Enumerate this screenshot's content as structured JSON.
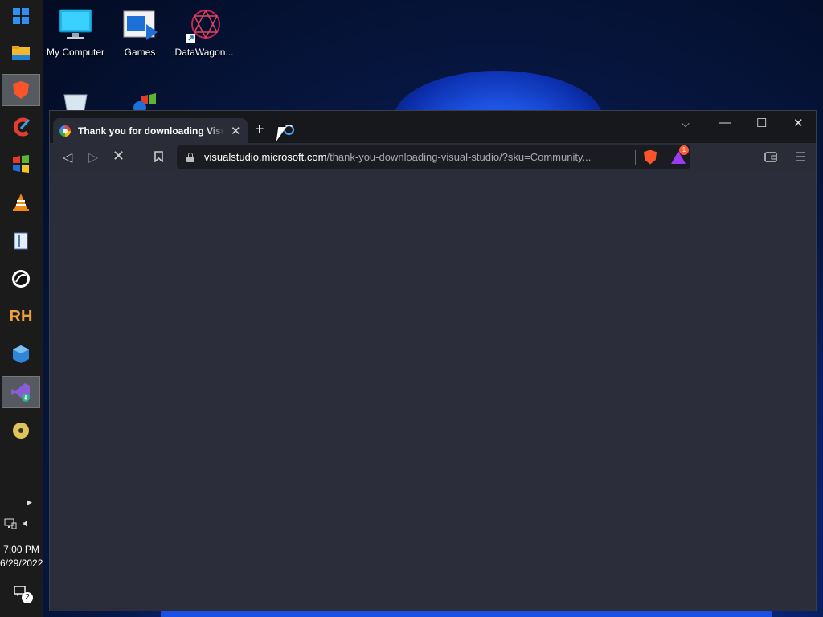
{
  "desktop": {
    "icons": [
      {
        "label": "My Computer",
        "icon": "monitor-icon"
      },
      {
        "label": "Games",
        "icon": "games-icon"
      },
      {
        "label": "DataWagon...",
        "icon": "datawagon-icon"
      }
    ]
  },
  "taskbar": {
    "apps": [
      {
        "icon": "windows-start-icon"
      },
      {
        "icon": "file-explorer-icon"
      },
      {
        "icon": "brave-browser-icon",
        "active": true
      },
      {
        "icon": "ccleaner-icon"
      },
      {
        "icon": "windows-xp-icon"
      },
      {
        "icon": "vlc-icon"
      },
      {
        "icon": "book-reader-icon"
      },
      {
        "icon": "inkscape-icon"
      },
      {
        "icon": "resource-hacker-icon"
      },
      {
        "icon": "cube-app-icon"
      },
      {
        "icon": "visual-studio-installer-icon",
        "active": true
      },
      {
        "icon": "dvd-icon"
      }
    ],
    "clock": {
      "time": "7:00 PM",
      "date": "6/29/2022"
    },
    "notifications_count": "2"
  },
  "browser": {
    "tab": {
      "title": "Thank you for downloading Visual Studio"
    },
    "url": {
      "host": "visualstudio.microsoft.com",
      "path": "/thank-you-downloading-visual-studio/?sku=Community..."
    },
    "rewards_badge": "1",
    "colors": {
      "background": "#2b2d3a",
      "titlebar": "#17181c",
      "spinner": "#4aa8ff"
    }
  }
}
